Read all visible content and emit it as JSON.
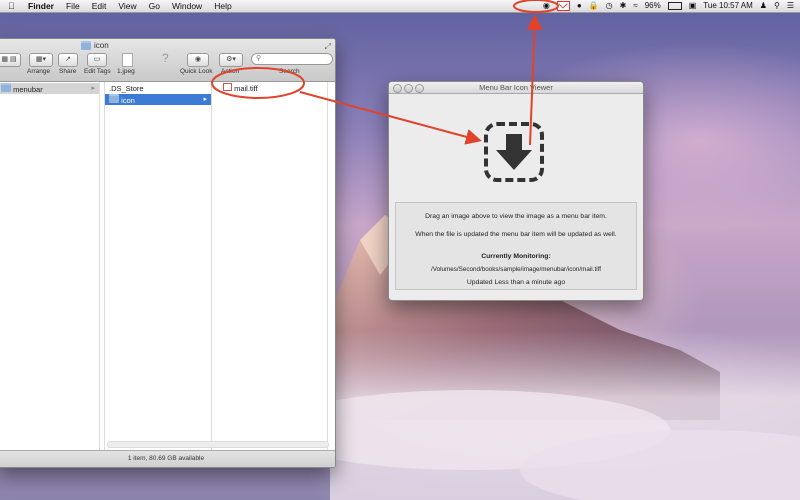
{
  "menubar": {
    "app_name": "Finder",
    "menus": [
      "File",
      "Edit",
      "View",
      "Go",
      "Window",
      "Help"
    ],
    "battery_percent": "96%",
    "clock": "Tue 10:57 AM"
  },
  "finder": {
    "title": "icon",
    "toolbar": {
      "arrange": "Arrange",
      "share": "Share",
      "edit_tags": "Edit Tags",
      "preview_file": "1.jpeg",
      "quick_look": "Quick Look",
      "action": "Action",
      "search": "Search"
    },
    "column1": [
      {
        "label": "menubar"
      }
    ],
    "column2": [
      {
        "label": ".DS_Store"
      },
      {
        "label": "icon"
      }
    ],
    "column3": [
      {
        "label": "mail.tiff"
      }
    ],
    "status": "1 item, 80.69 GB available"
  },
  "viewer": {
    "title": "Menu Bar Icon Viewer",
    "instruction": "Drag an image above to view the image as a menu bar item.",
    "update_note": "When the file is updated the menu bar item will be updated as well.",
    "monitoring_label": "Currently Monitoring:",
    "monitoring_path": "/Volumes/Second/books/sample/image/menubar/icon/mail.tiff",
    "updated": "Updated Less than a minute ago"
  },
  "colors": {
    "annotation": "#e0432a",
    "selection": "#3b7bd6"
  }
}
